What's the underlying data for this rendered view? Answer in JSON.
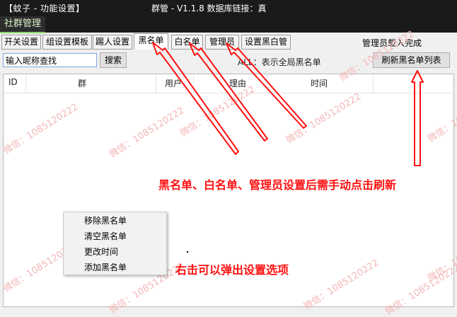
{
  "window": {
    "title_left": "【蚊子 - 功能设置】",
    "title_center": "群管 - V1.1.8  数据库链接：真"
  },
  "subtab": {
    "label": "社群管理"
  },
  "tabs": [
    {
      "label": "开关设置"
    },
    {
      "label": "组设置模板"
    },
    {
      "label": "踢人设置"
    },
    {
      "label": "黑名单"
    },
    {
      "label": "白名单"
    },
    {
      "label": "管理员"
    },
    {
      "label": "设置黑白管"
    }
  ],
  "status": "管理员载入完成",
  "search": {
    "value": "输入昵称查找",
    "button": "搜索"
  },
  "hint": "ALL：表示全局黑名单",
  "refresh_button": "刷新黑名单列表",
  "table": {
    "headers": [
      "ID",
      "群",
      "用户",
      "理由",
      "时间"
    ]
  },
  "context_menu": {
    "items": [
      "移除黑名单",
      "清空黑名单",
      "更改时间",
      "添加黑名单"
    ]
  },
  "annotations": {
    "note_refresh": "黑名单、白名单、管理员设置后需手动点击刷新",
    "note_rightclick": "右击可以弹出设置选项"
  },
  "watermark": "微信：1085120222",
  "colors": {
    "annotation": "#ff1010",
    "watermark": "#f4b6b6",
    "subtab_accent": "#8ad36a"
  }
}
